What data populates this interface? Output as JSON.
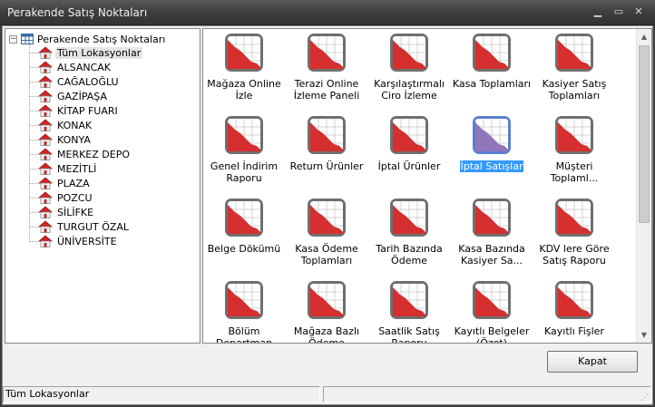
{
  "window": {
    "title": "Perakende Satış Noktaları",
    "min_glyph": "▁",
    "max_glyph": "▭",
    "close_glyph": "✕"
  },
  "tree": {
    "root_label": "Perakende Satış Noktaları",
    "expander_glyph": "−",
    "items": [
      {
        "label": "Tüm Lokasyonlar",
        "selected": true
      },
      {
        "label": "ALSANCAK"
      },
      {
        "label": "CAĞALOĞLU"
      },
      {
        "label": "GAZİPAŞA"
      },
      {
        "label": "KİTAP FUARI"
      },
      {
        "label": "KONAK"
      },
      {
        "label": "KONYA"
      },
      {
        "label": "MERKEZ DEPO"
      },
      {
        "label": "MEZİTLİ"
      },
      {
        "label": "PLAZA"
      },
      {
        "label": "POZCU"
      },
      {
        "label": "SİLİFKE"
      },
      {
        "label": "TURGUT ÖZAL"
      },
      {
        "label": "ÜNİVERSİTE"
      }
    ]
  },
  "reports": [
    {
      "label": "Mağaza Online İzle"
    },
    {
      "label": "Terazi Online İzleme Paneli"
    },
    {
      "label": "Karşılaştırmalı Ciro İzleme Paneli"
    },
    {
      "label": "Kasa Toplamları"
    },
    {
      "label": "Kasiyer Satış Toplamları"
    },
    {
      "label": "Genel İndirim Raporu"
    },
    {
      "label": "Return Ürünler"
    },
    {
      "label": "İptal Ürünler"
    },
    {
      "label": "İptal Satışlar",
      "selected": true
    },
    {
      "label": "Müşteri Toplaml..."
    },
    {
      "label": "Belge Dökümü"
    },
    {
      "label": "Kasa Ödeme Toplamları"
    },
    {
      "label": "Tarih Bazında Ödeme Toplamları"
    },
    {
      "label": "Kasa Bazında Kasiyer Sa..."
    },
    {
      "label": "KDV lere Göre Satış Raporu"
    },
    {
      "label": "Bölüm Departman Satışları"
    },
    {
      "label": "Mağaza Bazlı Ödeme Toplamları"
    },
    {
      "label": "Saatlik Satış Raporu"
    },
    {
      "label": "Kayıtlı Belgeler (Özet)"
    },
    {
      "label": "Kayıtlı Fişler"
    }
  ],
  "buttons": {
    "close_label": "Kapat"
  },
  "scrollbar": {
    "up_glyph": "▲",
    "down_glyph": "▼"
  },
  "statusbar": {
    "panel1": "Tüm Lokasyonlar",
    "panel2": "",
    "grip_glyph": "⋰"
  },
  "colors": {
    "icon_red": "#d42424",
    "selection_blue": "#3399ff",
    "titlebar": "#3f3f3f"
  }
}
